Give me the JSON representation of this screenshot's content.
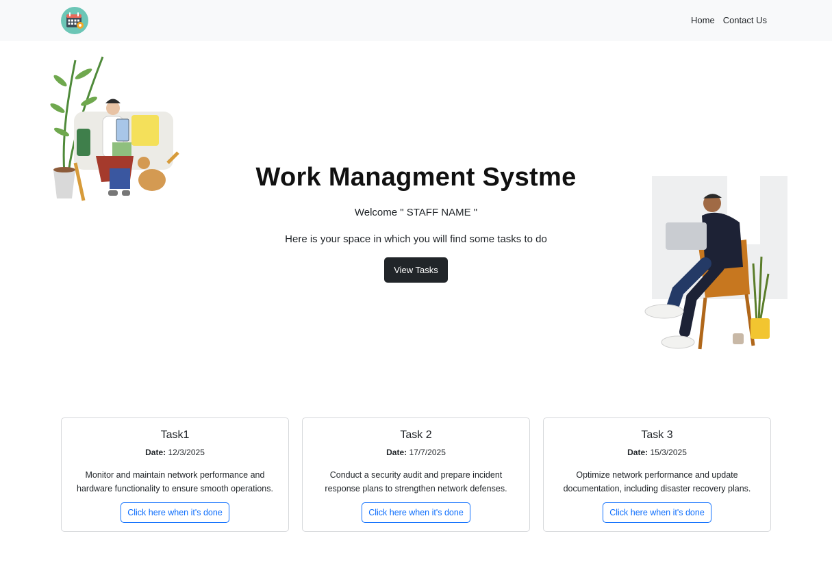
{
  "nav": {
    "logo_icon": "calendar-gear-icon",
    "links": [
      {
        "label": "Home"
      },
      {
        "label": "Contact Us"
      }
    ]
  },
  "hero": {
    "title": "Work Managment Systme",
    "welcome": "Welcome \" STAFF NAME \"",
    "subtitle": "Here is your space in which you will find some tasks to do",
    "button_label": "View Tasks",
    "left_illustration": "person-reading-on-couch-illustration",
    "right_illustration": "person-on-laptop-in-chair-illustration"
  },
  "tasks": [
    {
      "title": "Task1",
      "date_label": "Date:",
      "date": "12/3/2025",
      "description": "Monitor and maintain network performance and hardware functionality to ensure smooth operations.",
      "button_label": "Click here when it's done"
    },
    {
      "title": "Task 2",
      "date_label": "Date:",
      "date": "17/7/2025",
      "description": "Conduct a security audit and prepare incident response plans to strengthen network defenses.",
      "button_label": "Click here when it's done"
    },
    {
      "title": "Task 3",
      "date_label": "Date:",
      "date": "15/3/2025",
      "description": "Optimize network performance and update documentation, including disaster recovery plans.",
      "button_label": "Click here when it's done"
    }
  ],
  "colors": {
    "navbar_bg": "#f8f9fa",
    "primary": "#0d6efd",
    "dark_button": "#212529",
    "logo_bg": "#6cc6b6"
  }
}
